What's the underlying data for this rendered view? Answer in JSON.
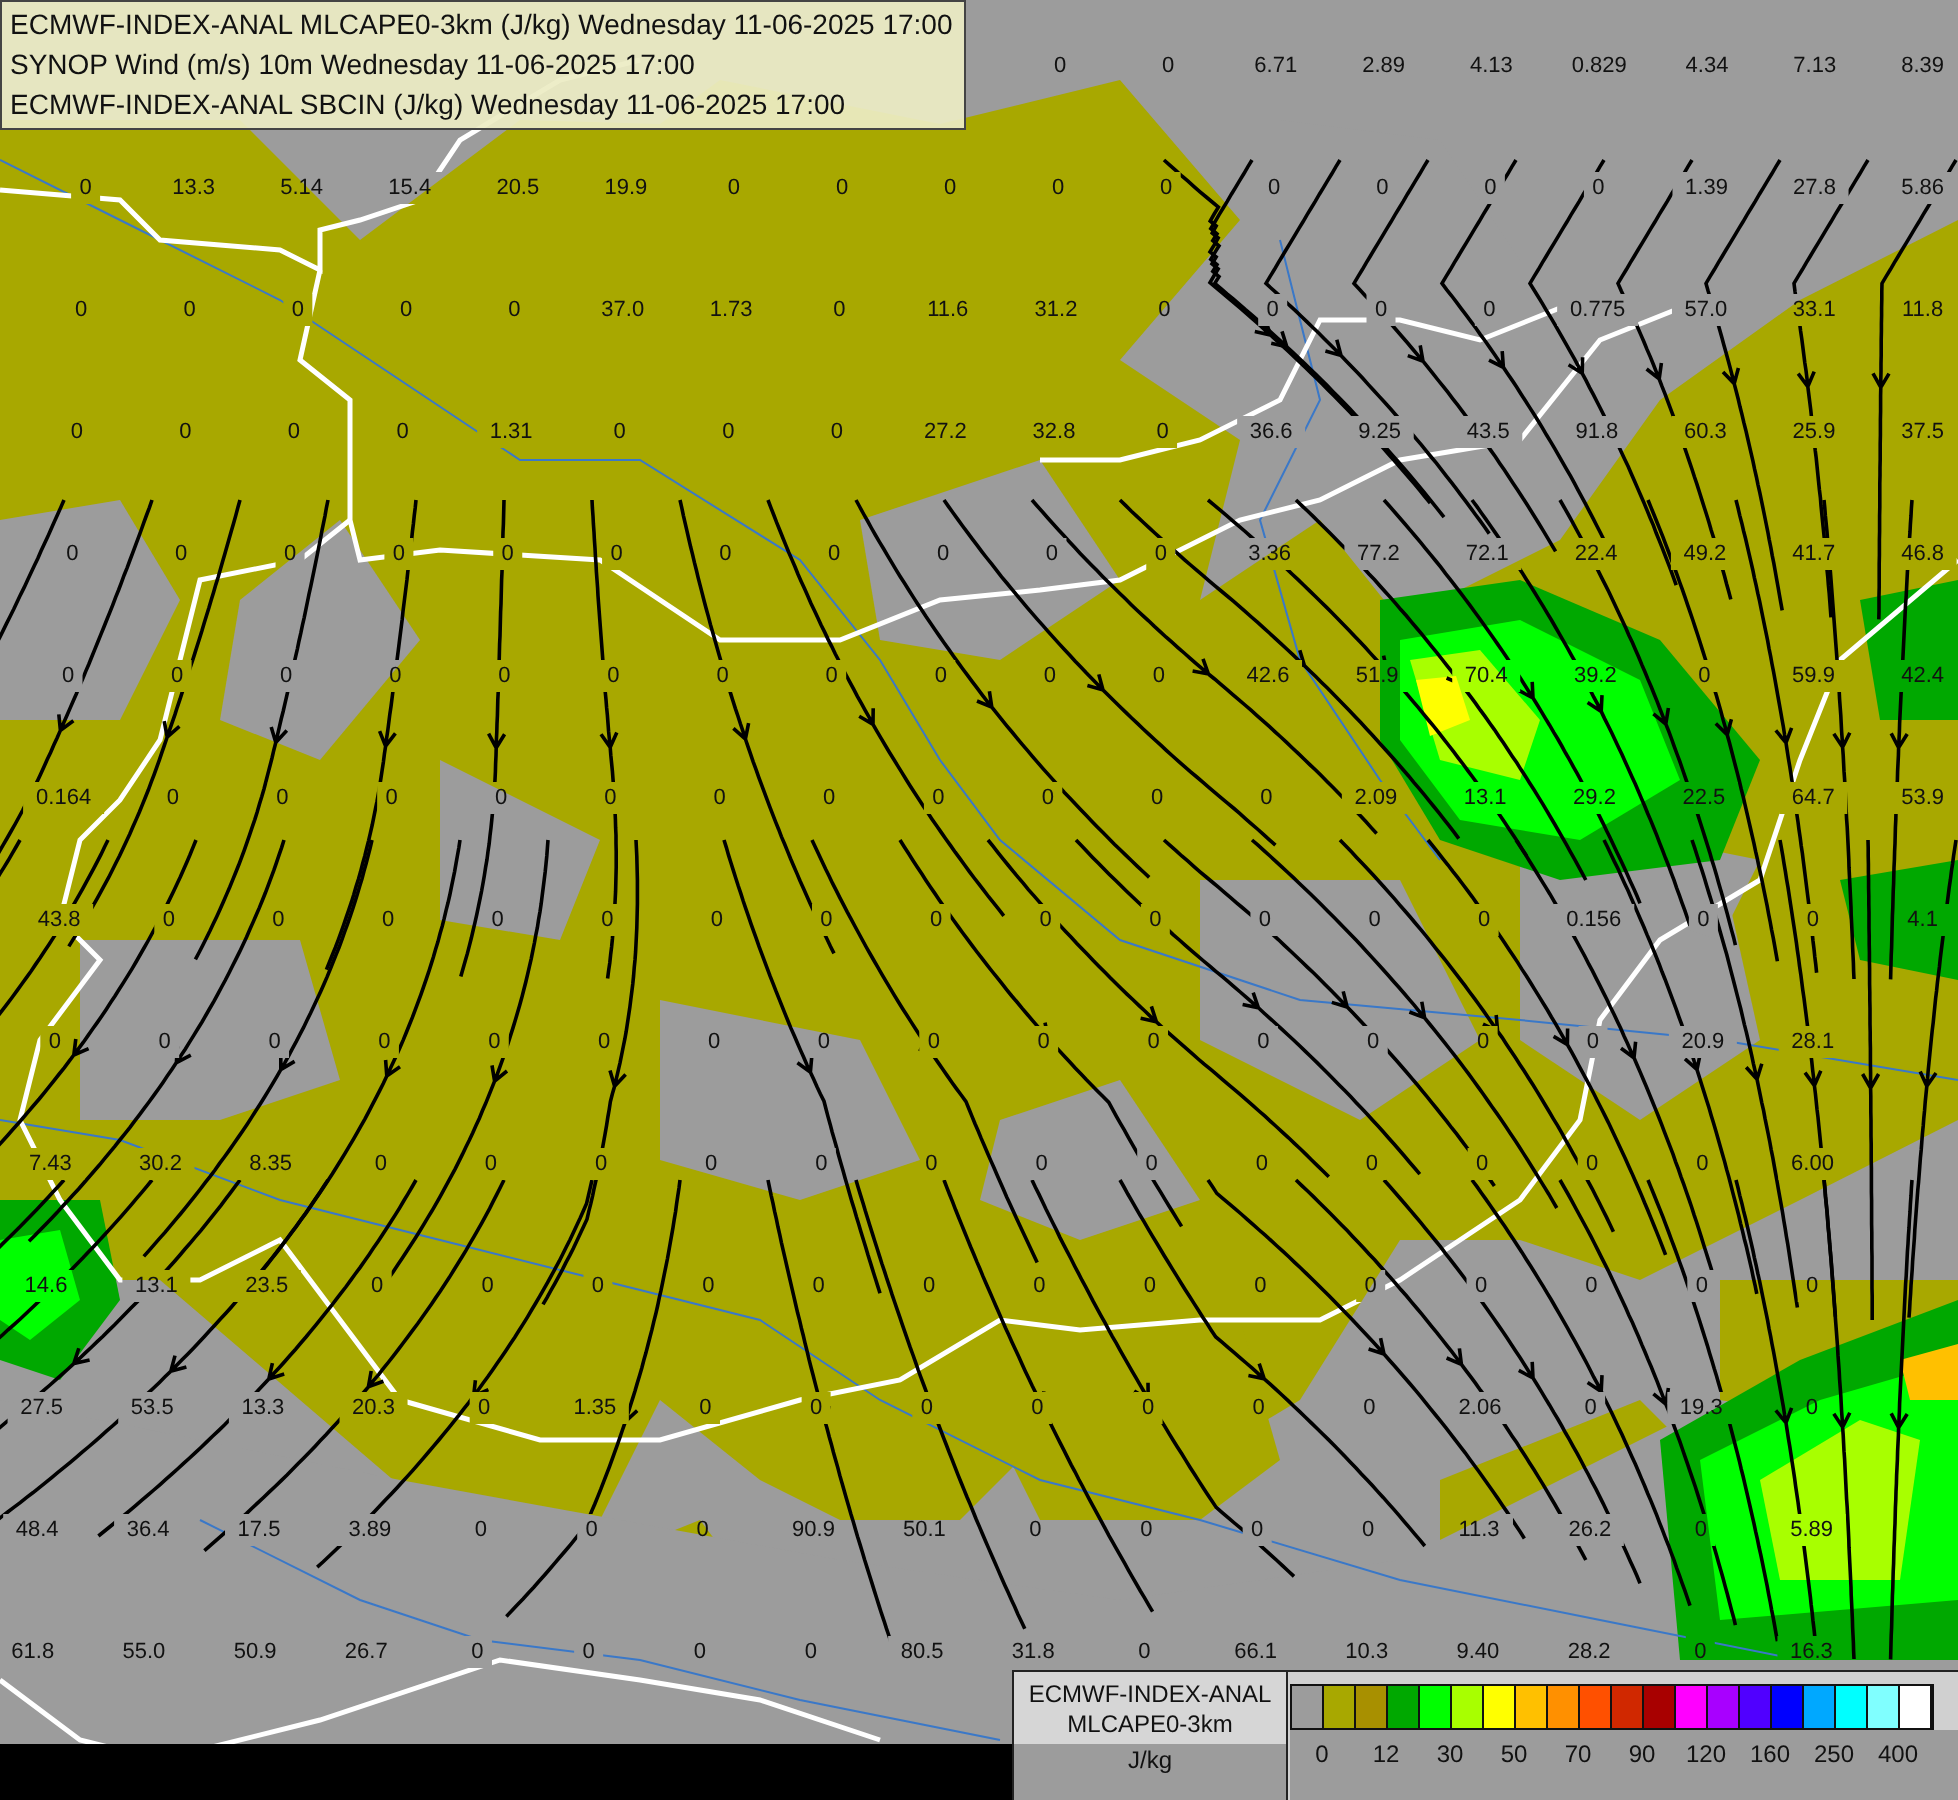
{
  "header": {
    "lines": [
      "ECMWF-INDEX-ANAL MLCAPE0-3km (J/kg) Wednesday 11-06-2025 17:00",
      "SYNOP Wind (m/s) 10m Wednesday 11-06-2025 17:00",
      "ECMWF-INDEX-ANAL SBCIN (J/kg) Wednesday 11-06-2025 17:00"
    ]
  },
  "map": {
    "top_right_values": [
      "0",
      "0",
      "6.71",
      "2.89",
      "4.13",
      "0.829",
      "4.34",
      "7.13",
      "8.39"
    ],
    "value_rows": [
      [
        "0",
        "13.3",
        "5.14",
        "15.4",
        "20.5",
        "19.9",
        "0",
        "0",
        "0",
        "0",
        "0",
        "0",
        "0",
        "0",
        "0",
        "1.39",
        "27.8",
        "5.86"
      ],
      [
        "0",
        "0",
        "0",
        "0",
        "0",
        "37.0",
        "1.73",
        "0",
        "11.6",
        "31.2",
        "0",
        "0",
        "0",
        "0",
        "0.775",
        "57.0",
        "33.1",
        "11.8"
      ],
      [
        "0",
        "0",
        "0",
        "0",
        "1.31",
        "0",
        "0",
        "0",
        "27.2",
        "32.8",
        "0",
        "36.6",
        "9.25",
        "43.5",
        "91.8",
        "60.3",
        "25.9",
        "37.5"
      ],
      [
        "0",
        "0",
        "0",
        "0",
        "0",
        "0",
        "0",
        "0",
        "0",
        "0",
        "0",
        "3.36",
        "77.2",
        "72.1",
        "22.4",
        "49.2",
        "41.7",
        "46.8"
      ],
      [
        "0",
        "0",
        "0",
        "0",
        "0",
        "0",
        "0",
        "0",
        "0",
        "0",
        "0",
        "42.6",
        "51.9",
        "70.4",
        "39.2",
        "0",
        "59.9",
        "42.4"
      ],
      [
        "0.164",
        "0",
        "0",
        "0",
        "0",
        "0",
        "0",
        "0",
        "0",
        "0",
        "0",
        "0",
        "2.09",
        "13.1",
        "29.2",
        "22.5",
        "64.7",
        "53.9"
      ],
      [
        "43.8",
        "0",
        "0",
        "0",
        "0",
        "0",
        "0",
        "0",
        "0",
        "0",
        "0",
        "0",
        "0",
        "0",
        "0.156",
        "0",
        "0",
        "4.1"
      ],
      [
        "0",
        "0",
        "0",
        "0",
        "0",
        "0",
        "0",
        "0",
        "0",
        "0",
        "0",
        "0",
        "0",
        "0",
        "0",
        "20.9",
        "28.1"
      ],
      [
        "7.43",
        "30.2",
        "8.35",
        "0",
        "0",
        "0",
        "0",
        "0",
        "0",
        "0",
        "0",
        "0",
        "0",
        "0",
        "0",
        "0",
        "6.00"
      ],
      [
        "14.6",
        "13.1",
        "23.5",
        "0",
        "0",
        "0",
        "0",
        "0",
        "0",
        "0",
        "0",
        "0",
        "0",
        "0",
        "0",
        "0",
        "0"
      ],
      [
        "27.5",
        "53.5",
        "13.3",
        "20.3",
        "0",
        "1.35",
        "0",
        "0",
        "0",
        "0",
        "0",
        "0",
        "0",
        "2.06",
        "0",
        "19.3",
        "0"
      ],
      [
        "48.4",
        "36.4",
        "17.5",
        "3.89",
        "0",
        "0",
        "0",
        "90.9",
        "50.1",
        "0",
        "0",
        "0",
        "0",
        "11.3",
        "26.2",
        "0",
        "5.89"
      ],
      [
        "61.8",
        "55.0",
        "50.9",
        "26.7",
        "0",
        "0",
        "0",
        "0",
        "80.5",
        "31.8",
        "0",
        "66.1",
        "10.3",
        "9.40",
        "28.2",
        "0",
        "16.3"
      ]
    ]
  },
  "legend": {
    "title_lines": [
      "ECMWF-INDEX-ANAL",
      "MLCAPE0-3km"
    ],
    "unit": "J/kg",
    "swatches": [
      {
        "color": "#9c9c9c"
      },
      {
        "color": "#a8a800"
      },
      {
        "color": "#a89000"
      },
      {
        "color": "#00a800"
      },
      {
        "color": "#00ff00"
      },
      {
        "color": "#a8ff00"
      },
      {
        "color": "#ffff00"
      },
      {
        "color": "#ffc000"
      },
      {
        "color": "#ff9000"
      },
      {
        "color": "#ff5000"
      },
      {
        "color": "#d02800"
      },
      {
        "color": "#a80000"
      },
      {
        "color": "#ff00ff"
      },
      {
        "color": "#a800ff"
      },
      {
        "color": "#5000ff"
      },
      {
        "color": "#0000ff"
      },
      {
        "color": "#00a8ff"
      },
      {
        "color": "#00ffff"
      },
      {
        "color": "#80ffff"
      },
      {
        "color": "#ffffff"
      }
    ],
    "ticks": [
      "0",
      "12",
      "30",
      "50",
      "70",
      "90",
      "120",
      "160",
      "250",
      "400"
    ]
  }
}
